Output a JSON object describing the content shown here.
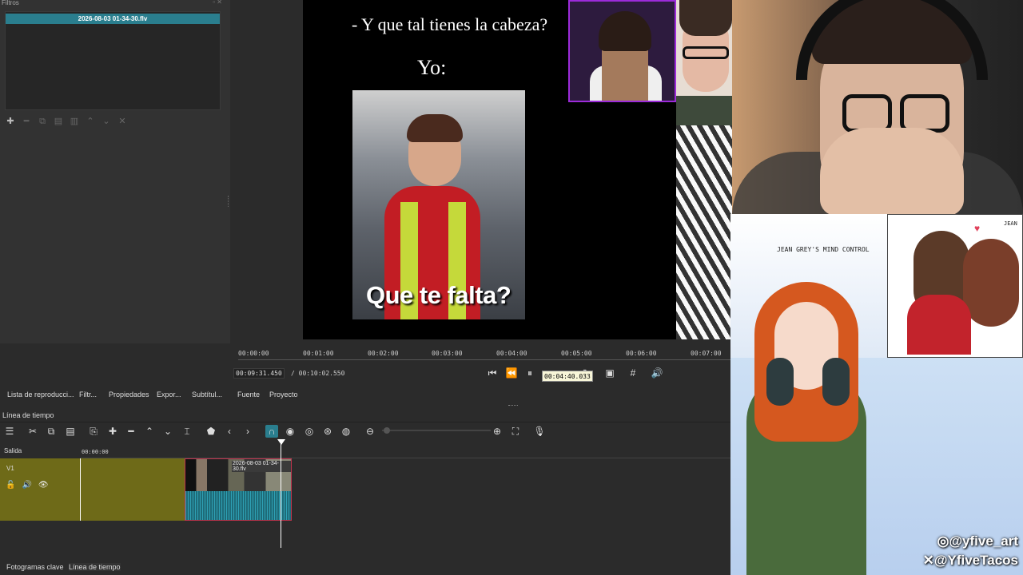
{
  "filters_panel": {
    "title": "Filtros",
    "selected_file": "2026-08-03 01-34-30.flv",
    "toolbar": [
      "add-icon",
      "remove-icon",
      "copy-icon",
      "paste-icon",
      "delete-icon",
      "move-up-icon",
      "move-down-icon",
      "deselect-icon"
    ]
  },
  "video": {
    "meme_line1": "- Y que tal tienes la cabeza?",
    "meme_line2": "Yo:",
    "meme_caption": "Que te falta?",
    "art_title": "JEAN GREY'S MIND CONTROL",
    "art_panel_label": "JEAN",
    "handle_instagram": "@yfive_art",
    "handle_x": "@YfiveTacos"
  },
  "transport": {
    "ruler_labels": [
      "00:00:00",
      "00:01:00",
      "00:02:00",
      "00:03:00",
      "00:04:00",
      "00:05:00",
      "00:06:00",
      "00:07:00"
    ],
    "current_time": "00:09:31.450",
    "total_time": "/ 00:10:02.550",
    "tooltip": "00:04:40.033"
  },
  "tabs": [
    "Lista de reproducci...",
    "Filtr...",
    "Propiedades",
    "Expor...",
    "Subtítul...",
    "Fuente",
    "Proyecto"
  ],
  "timeline": {
    "title": "Línea de tiempo",
    "output_label": "Salida",
    "ruler_start": "00:00:00",
    "track_name": "V1",
    "clip_label": "2026-08-03 01-34-30.flv"
  },
  "bottom_tabs": [
    "Fotogramas clave",
    "Línea de tiempo"
  ],
  "colors": {
    "accent": "#2a7e8e",
    "track": "#6e6a18",
    "clip_border": "#c2334d"
  }
}
